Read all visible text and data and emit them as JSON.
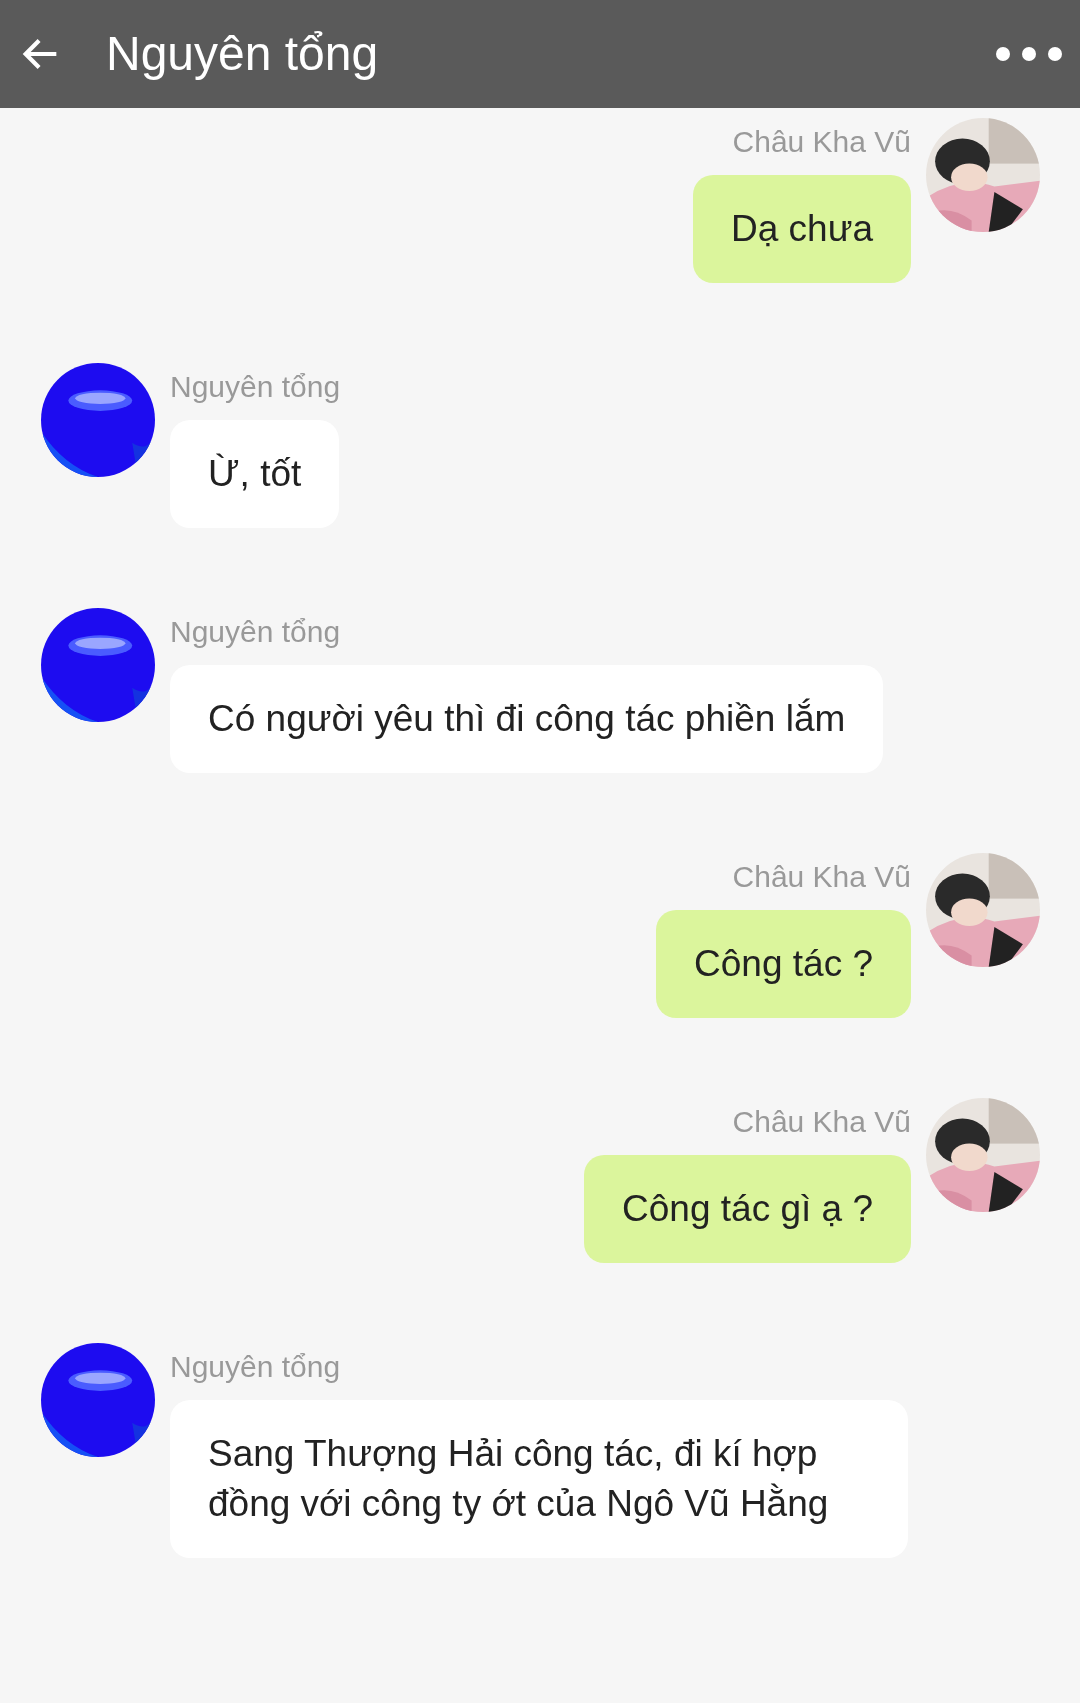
{
  "header": {
    "title": "Nguyên tổng"
  },
  "messages": [
    {
      "kind": "sent",
      "sender": "Châu Kha Vũ",
      "text": "Dạ chưa"
    },
    {
      "kind": "received",
      "sender": "Nguyên tổng",
      "text": "Ừ, tốt"
    },
    {
      "kind": "received",
      "sender": "Nguyên tổng",
      "text": "Có người yêu thì đi công tác phiền lắm"
    },
    {
      "kind": "sent",
      "sender": "Châu Kha Vũ",
      "text": "Công tác ?"
    },
    {
      "kind": "sent",
      "sender": "Châu Kha Vũ",
      "text": "Công tác gì ạ ?"
    },
    {
      "kind": "received",
      "sender": "Nguyên tổng",
      "text": "Sang Thượng Hải công tác, đi kí hợp đồng với công ty ớt của Ngô Vũ Hằng"
    }
  ]
}
